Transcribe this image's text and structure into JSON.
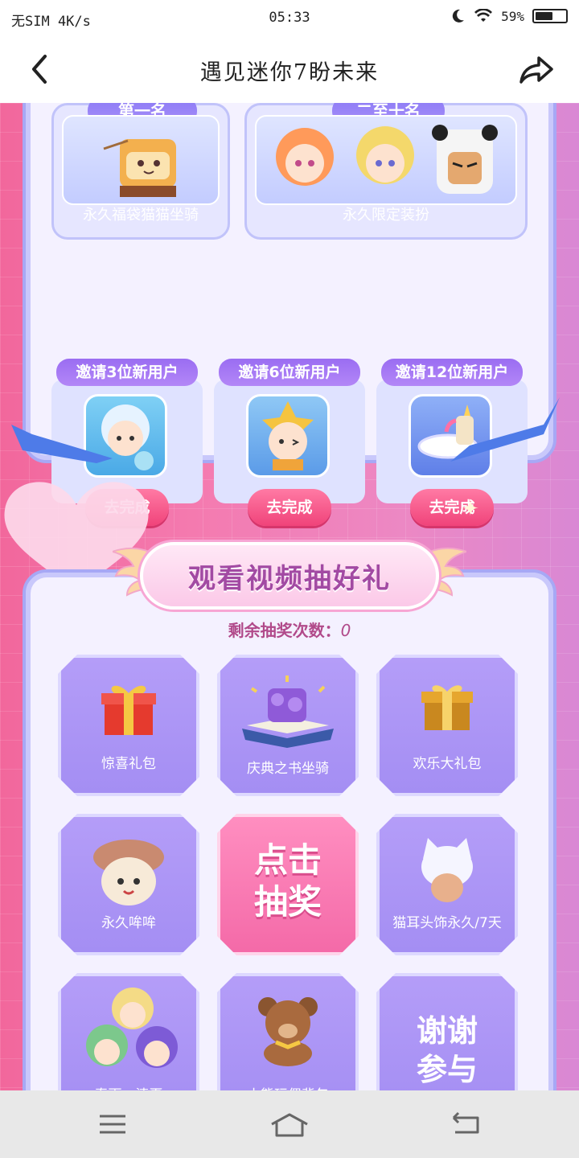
{
  "status_bar": {
    "carrier": "无SIM 4K/s",
    "time": "05:33",
    "battery": "59%",
    "battery_level": 0.59
  },
  "nav": {
    "title": "遇见迷你7盼未来"
  },
  "top_prizes": [
    {
      "rank": "第一名",
      "label": "永久福袋猫猫坐骑"
    },
    {
      "rank": "二至十名",
      "label": "永久限定装扮"
    }
  ],
  "tasks": [
    {
      "title": "邀请3位新用户",
      "button": "去完成"
    },
    {
      "title": "邀请6位新用户",
      "button": "去完成"
    },
    {
      "title": "邀请12位新用户",
      "button": "去完成"
    }
  ],
  "lottery": {
    "title": "观看视频抽好礼",
    "remaining_label": "剩余抽奖次数：",
    "remaining_count": "0",
    "grid": [
      {
        "label": "惊喜礼包",
        "icon": "red-gift-box-icon"
      },
      {
        "label": "庆典之书坐骑",
        "icon": "celebration-book-icon"
      },
      {
        "label": "欢乐大礼包",
        "icon": "gold-gift-box-icon"
      },
      {
        "label": "永久哞哞",
        "icon": "cow-avatar-icon"
      },
      {
        "label": "点击\n抽奖",
        "line1": "点击",
        "line2": "抽奖"
      },
      {
        "label": "猫耳头饰永久/7天",
        "icon": "cat-ear-headwear-icon"
      },
      {
        "label": "春雨、清夏",
        "icon": "characters-icon"
      },
      {
        "label": "小熊玩偶背包",
        "icon": "teddy-bear-icon"
      },
      {
        "label": "谢谢参与",
        "line1": "谢谢",
        "line2": "参与"
      }
    ]
  }
}
